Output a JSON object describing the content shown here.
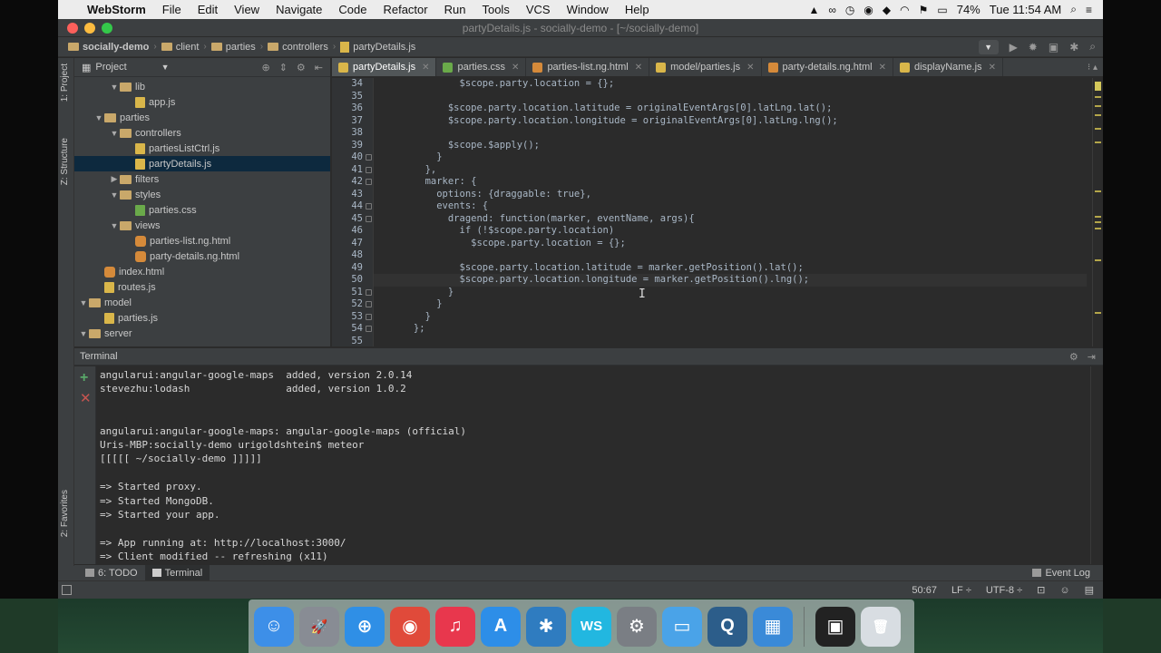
{
  "menubar": {
    "app_name": "WebStorm",
    "items": [
      "File",
      "Edit",
      "View",
      "Navigate",
      "Code",
      "Refactor",
      "Run",
      "Tools",
      "VCS",
      "Window",
      "Help"
    ],
    "battery": "74%",
    "clock": "Tue 11:54 AM"
  },
  "window": {
    "title": "partyDetails.js - socially-demo - [~/socially-demo]"
  },
  "breadcrumbs": [
    "socially-demo",
    "client",
    "parties",
    "controllers",
    "partyDetails.js"
  ],
  "project_panel": {
    "title": "Project",
    "tree": [
      {
        "label": "lib",
        "kind": "folder",
        "arrow": "▼",
        "depth": 2
      },
      {
        "label": "app.js",
        "kind": "js",
        "arrow": "",
        "depth": 3
      },
      {
        "label": "parties",
        "kind": "folder",
        "arrow": "▼",
        "depth": 1
      },
      {
        "label": "controllers",
        "kind": "folder",
        "arrow": "▼",
        "depth": 2
      },
      {
        "label": "partiesListCtrl.js",
        "kind": "js",
        "arrow": "",
        "depth": 3
      },
      {
        "label": "partyDetails.js",
        "kind": "js",
        "arrow": "",
        "depth": 3,
        "selected": true
      },
      {
        "label": "filters",
        "kind": "folder",
        "arrow": "▶",
        "depth": 2
      },
      {
        "label": "styles",
        "kind": "folder",
        "arrow": "▼",
        "depth": 2
      },
      {
        "label": "parties.css",
        "kind": "css",
        "arrow": "",
        "depth": 3
      },
      {
        "label": "views",
        "kind": "folder",
        "arrow": "▼",
        "depth": 2
      },
      {
        "label": "parties-list.ng.html",
        "kind": "html",
        "arrow": "",
        "depth": 3
      },
      {
        "label": "party-details.ng.html",
        "kind": "html",
        "arrow": "",
        "depth": 3
      },
      {
        "label": "index.html",
        "kind": "html",
        "arrow": "",
        "depth": 1
      },
      {
        "label": "routes.js",
        "kind": "js",
        "arrow": "",
        "depth": 1
      },
      {
        "label": "model",
        "kind": "folder",
        "arrow": "▼",
        "depth": 0
      },
      {
        "label": "parties.js",
        "kind": "js",
        "arrow": "",
        "depth": 1
      },
      {
        "label": "server",
        "kind": "folder",
        "arrow": "▼",
        "depth": 0
      }
    ]
  },
  "left_tabs": {
    "project": "1: Project",
    "structure": "Z: Structure",
    "favorites": "2: Favorites"
  },
  "editor_tabs": [
    {
      "label": "partyDetails.js",
      "kind": "js",
      "active": true
    },
    {
      "label": "parties.css",
      "kind": "css"
    },
    {
      "label": "parties-list.ng.html",
      "kind": "html"
    },
    {
      "label": "model/parties.js",
      "kind": "js"
    },
    {
      "label": "party-details.ng.html",
      "kind": "html"
    },
    {
      "label": "displayName.js",
      "kind": "js"
    }
  ],
  "code": [
    {
      "n": "34",
      "text": "              $scope.party.location = {};",
      "fold": false
    },
    {
      "n": "35",
      "text": "",
      "fold": false
    },
    {
      "n": "36",
      "text": "            $scope.party.location.latitude = originalEventArgs[0].latLng.lat();",
      "fold": false
    },
    {
      "n": "37",
      "text": "            $scope.party.location.longitude = originalEventArgs[0].latLng.lng();",
      "fold": false
    },
    {
      "n": "38",
      "text": "",
      "fold": false
    },
    {
      "n": "39",
      "text": "            $scope.$apply();",
      "fold": false
    },
    {
      "n": "40",
      "text": "          }",
      "fold": true
    },
    {
      "n": "41",
      "text": "        },",
      "fold": true
    },
    {
      "n": "42",
      "text": "        marker: {",
      "fold": true
    },
    {
      "n": "43",
      "text": "          options: {draggable: true},",
      "fold": false
    },
    {
      "n": "44",
      "text": "          events: {",
      "fold": true
    },
    {
      "n": "45",
      "text": "            dragend: function(marker, eventName, args){",
      "fold": true
    },
    {
      "n": "46",
      "text": "              if (!$scope.party.location)",
      "fold": false
    },
    {
      "n": "47",
      "text": "                $scope.party.location = {};",
      "fold": false
    },
    {
      "n": "48",
      "text": "",
      "fold": false
    },
    {
      "n": "49",
      "text": "              $scope.party.location.latitude = marker.getPosition().lat();",
      "fold": false
    },
    {
      "n": "50",
      "text": "              $scope.party.location.longitude = marker.getPosition().lng();",
      "fold": false,
      "current": true
    },
    {
      "n": "51",
      "text": "            }",
      "fold": true
    },
    {
      "n": "52",
      "text": "          }",
      "fold": true
    },
    {
      "n": "53",
      "text": "        }",
      "fold": true
    },
    {
      "n": "54",
      "text": "      };",
      "fold": true
    },
    {
      "n": "55",
      "text": "",
      "fold": false
    }
  ],
  "terminal": {
    "title": "Terminal",
    "lines": [
      "angularui:angular-google-maps  added, version 2.0.14",
      "stevezhu:lodash                added, version 1.0.2",
      "",
      "",
      "angularui:angular-google-maps: angular-google-maps (official)",
      "Uris-MBP:socially-demo urigoldshtein$ meteor",
      "[[[[[ ~/socially-demo ]]]]]",
      "",
      "=> Started proxy.",
      "=> Started MongoDB.",
      "=> Started your app.",
      "",
      "=> App running at: http://localhost:3000/",
      "=> Client modified -- refreshing (x11)"
    ]
  },
  "toolwindows": {
    "todo": "6: TODO",
    "terminal": "Terminal",
    "event_log": "Event Log"
  },
  "statusbar": {
    "position": "50:67",
    "line_sep": "LF ÷",
    "encoding": "UTF-8 ÷"
  },
  "dock": [
    {
      "name": "finder-icon",
      "color": "#3d8fe8",
      "glyph": "☺"
    },
    {
      "name": "launchpad-icon",
      "color": "#888c94",
      "glyph": "🚀"
    },
    {
      "name": "safari-icon",
      "color": "#2f8fe6",
      "glyph": "⊕"
    },
    {
      "name": "chrome-icon",
      "color": "#e04a3a",
      "glyph": "◉"
    },
    {
      "name": "itunes-icon",
      "color": "#e8374d",
      "glyph": "♫"
    },
    {
      "name": "app-store-icon",
      "color": "#2d8ee8",
      "glyph": "A"
    },
    {
      "name": "sourcetree-icon",
      "color": "#2f7cc0",
      "glyph": "✱"
    },
    {
      "name": "webstorm-icon",
      "color": "#22b7e0",
      "glyph": "WS"
    },
    {
      "name": "system-preferences-icon",
      "color": "#7a7e84",
      "glyph": "⚙"
    },
    {
      "name": "keynote-icon",
      "color": "#4aa3e8",
      "glyph": "▭"
    },
    {
      "name": "quicktime-icon",
      "color": "#2c5d8a",
      "glyph": "Q"
    },
    {
      "name": "preview-icon",
      "color": "#3a8ad8",
      "glyph": "▦"
    },
    {
      "name": "terminal-app-icon",
      "color": "#222222",
      "glyph": "▣"
    },
    {
      "name": "trash-icon",
      "color": "#d8dde2",
      "glyph": "🗑"
    }
  ]
}
